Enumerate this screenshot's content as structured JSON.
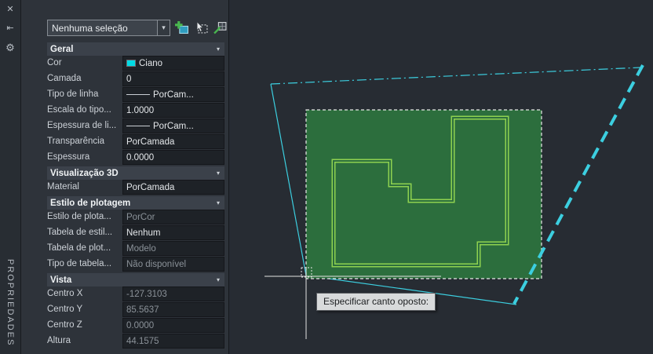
{
  "colors": {
    "cyan": "#3ccfe0",
    "house_green": "#8ed150",
    "selection_fill": "#2c6e3d",
    "crosshair": "#e3e3e3",
    "swatch_cyan": "#00dbe4"
  },
  "palette": {
    "title": "PROPRIEDADES",
    "titlebar_icons": {
      "close": "✕",
      "autohide": "⇤",
      "settings": "⚙"
    },
    "icons": {
      "dropdown_arrow": "▾",
      "section_chevron": "▾"
    },
    "selector_value": "Nenhuma seleção",
    "sections": [
      {
        "label": "Geral",
        "rows": [
          {
            "label": "Cor",
            "value": "Ciano",
            "swatch": true
          },
          {
            "label": "Camada",
            "value": "0"
          },
          {
            "label": "Tipo de linha",
            "value": "PorCam...",
            "line": true
          },
          {
            "label": "Escala do tipo...",
            "value": "1.0000"
          },
          {
            "label": "Espessura de li...",
            "value": "PorCam...",
            "line": true
          },
          {
            "label": "Transparência",
            "value": "PorCamada"
          },
          {
            "label": "Espessura",
            "value": "0.0000"
          }
        ]
      },
      {
        "label": "Visualização 3D",
        "rows": [
          {
            "label": "Material",
            "value": "PorCamada"
          }
        ]
      },
      {
        "label": "Estilo de plotagem",
        "rows": [
          {
            "label": "Estilo de plota...",
            "value": "PorCor",
            "disabled": true
          },
          {
            "label": "Tabela de estil...",
            "value": "Nenhum"
          },
          {
            "label": "Tabela de plot...",
            "value": "Modelo",
            "disabled": true
          },
          {
            "label": "Tipo de tabela...",
            "value": "Não disponível",
            "disabled": true
          }
        ]
      },
      {
        "label": "Vista",
        "rows": [
          {
            "label": "Centro X",
            "value": "-127.3103",
            "disabled": true
          },
          {
            "label": "Centro Y",
            "value": "85.5637",
            "disabled": true
          },
          {
            "label": "Centro Z",
            "value": "0.0000",
            "disabled": true
          },
          {
            "label": "Altura",
            "value": "44.1575",
            "disabled": true
          }
        ]
      }
    ]
  },
  "canvas": {
    "tooltip": "Especificar canto oposto:"
  }
}
